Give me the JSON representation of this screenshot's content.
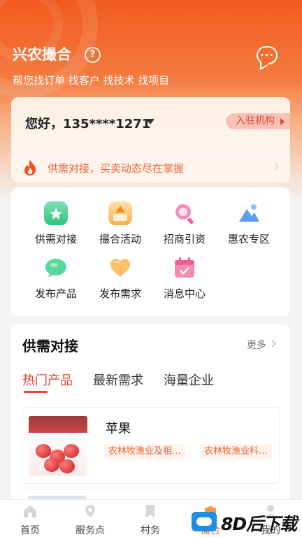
{
  "header": {
    "app_title": "兴农撮合",
    "subtitle": "帮您找订单 找客户 找技术 找项目"
  },
  "greeting": {
    "text": "您好，135****1271",
    "join_button": "入驻机构"
  },
  "supply_bar": {
    "text": "供需对接，买卖动态尽在掌握"
  },
  "shortcuts": [
    {
      "label": "供需对接",
      "icon": "badge-icon",
      "color": "#3ccf8e"
    },
    {
      "label": "撮合活动",
      "icon": "gift-box-icon",
      "color": "#f5a623"
    },
    {
      "label": "招商引资",
      "icon": "magnifier-icon",
      "color": "#f06aa8"
    },
    {
      "label": "惠农专区",
      "icon": "mountain-icon",
      "color": "#4a8df0"
    },
    {
      "label": "发布产品",
      "icon": "chat-bubble-icon",
      "color": "#4fd39a"
    },
    {
      "label": "发布需求",
      "icon": "heart-icon",
      "color": "#f5b146"
    },
    {
      "label": "消息中心",
      "icon": "calendar-icon",
      "color": "#f27aa6"
    }
  ],
  "supply_demand": {
    "title": "供需对接",
    "more": "更多",
    "tabs": [
      "热门产品",
      "最新需求",
      "海量企业"
    ],
    "active_tab": 0,
    "products": [
      {
        "name": "苹果",
        "tags": [
          "农林牧渔业及相…",
          "农林牧渔业科…"
        ]
      }
    ]
  },
  "tabbar": {
    "items": [
      {
        "label": "首页",
        "icon": "home-icon"
      },
      {
        "label": "服务点",
        "icon": "location-pin-icon"
      },
      {
        "label": "村务",
        "icon": "bookmark-icon"
      },
      {
        "label": "撮合",
        "icon": "shopping-bag-icon"
      },
      {
        "label": "我的",
        "icon": "user-icon"
      }
    ],
    "active": 3
  },
  "watermark": {
    "text": "8D后下载"
  },
  "colors": {
    "accent": "#e8452e",
    "header_orange": "#f15a1f",
    "tag_orange": "#e8643a"
  }
}
